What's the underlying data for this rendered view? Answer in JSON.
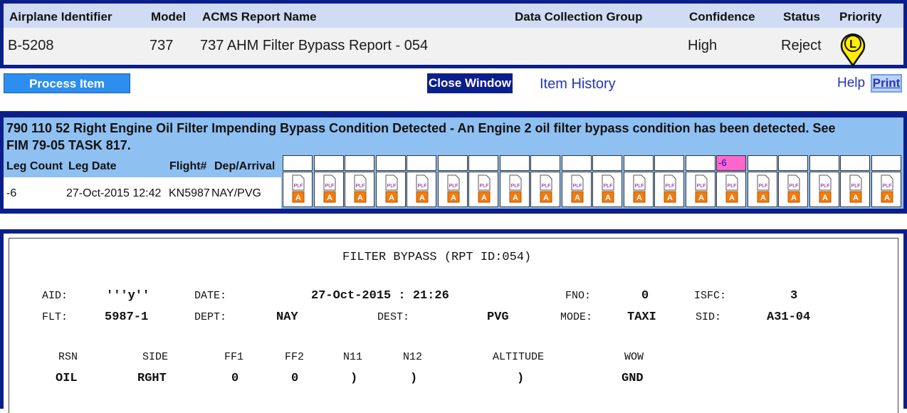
{
  "colors": {
    "frame": "#0b1f8c",
    "header_bg": "#cfdcf4",
    "message_bg": "#8fc0f2",
    "process_button": "#2e8ef0",
    "highlight_cell": "#ff66cc",
    "priority_pin": "#ffee00"
  },
  "table": {
    "headers": {
      "airplane_identifier": "Airplane Identifier",
      "model": "Model",
      "report_name": "ACMS Report Name",
      "data_collection_group": "Data Collection Group",
      "confidence": "Confidence",
      "status": "Status",
      "priority": "Priority"
    },
    "row": {
      "airplane_identifier": "B-5208",
      "model": "737",
      "report_name": "737 AHM Filter Bypass Report - 054",
      "data_collection_group": "",
      "confidence": "High",
      "status": "Reject",
      "priority": "L"
    }
  },
  "actions": {
    "process_item": "Process Item",
    "close_window": "Close Window",
    "item_history": "Item History",
    "help": "Help",
    "print": "Print"
  },
  "message": {
    "text": "790 110 52 Right Engine Oil Filter Impending Bypass Condition Detected - An Engine 2 oil filter bypass condition has been detected. See FIM 79-05 TASK 817."
  },
  "legs": {
    "headers": {
      "leg_count": "Leg Count",
      "leg_date": "Leg Date",
      "flight": "Flight#",
      "dep_arrival": "Dep/Arrival"
    },
    "row": {
      "leg_count": "-6",
      "leg_date": "27-Oct-2015 12:42",
      "flight": "KN5987",
      "dep_arrival": "NAY/PVG"
    },
    "grid_labels": [
      "",
      "",
      "",
      "",
      "",
      "",
      "",
      "",
      "",
      "",
      "",
      "",
      "",
      "",
      "-6",
      "",
      "",
      "",
      "",
      ""
    ],
    "icon_label": "PLF",
    "icon_badge": "A"
  },
  "report": {
    "title": "FILTER BYPASS (RPT ID:054)",
    "line1": {
      "aid_label": "AID:",
      "aid": "'''y''",
      "date_label": "DATE:",
      "date": "27-Oct-2015 : 21:26",
      "fno_label": "FNO:",
      "fno": "0",
      "isfc_label": "ISFC:",
      "isfc": "3"
    },
    "line2": {
      "flt_label": "FLT:",
      "flt": "5987-1",
      "dept_label": "DEPT:",
      "dept": "NAY",
      "dest_label": "DEST:",
      "dest": "PVG",
      "mode_label": "MODE:",
      "mode": "TAXI",
      "sid_label": "SID:",
      "sid": "A31-04"
    },
    "columns": {
      "rsn": "RSN",
      "side": "SIDE",
      "ff1": "FF1",
      "ff2": "FF2",
      "n11": "N11",
      "n12": "N12",
      "altitude": "ALTITUDE",
      "wow": "WOW"
    },
    "values": {
      "rsn": "OIL",
      "side": "RGHT",
      "ff1": "0",
      "ff2": "0",
      "n11": ")",
      "n12": ")",
      "altitude": ")",
      "wow": "GND"
    }
  }
}
